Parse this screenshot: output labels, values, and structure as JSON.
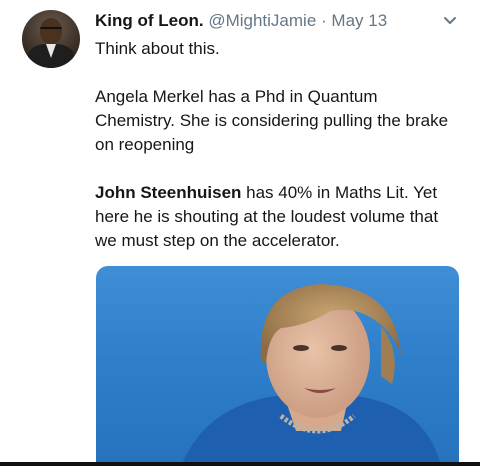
{
  "tweet": {
    "author_name": "King of Leon.",
    "handle": "@MightiJamie",
    "separator": "·",
    "date": "May 13",
    "paragraph1": "Think about this.",
    "paragraph2": "Angela Merkel has a Phd in Quantum Chemistry. She is considering pulling the brake on reopening",
    "paragraph3_bold": "John Steenhuisen",
    "paragraph3_rest": " has 40% in Maths Lit. Yet here he is shouting at the loudest volume that we must step on the accelerator."
  },
  "icons": {
    "avatar": "profile-photo",
    "menu": "chevron-down-icon"
  },
  "colors": {
    "text": "#14171a",
    "secondary": "#657786",
    "media_background": "#2f7fcb",
    "jacket": "#1f5fb0"
  }
}
